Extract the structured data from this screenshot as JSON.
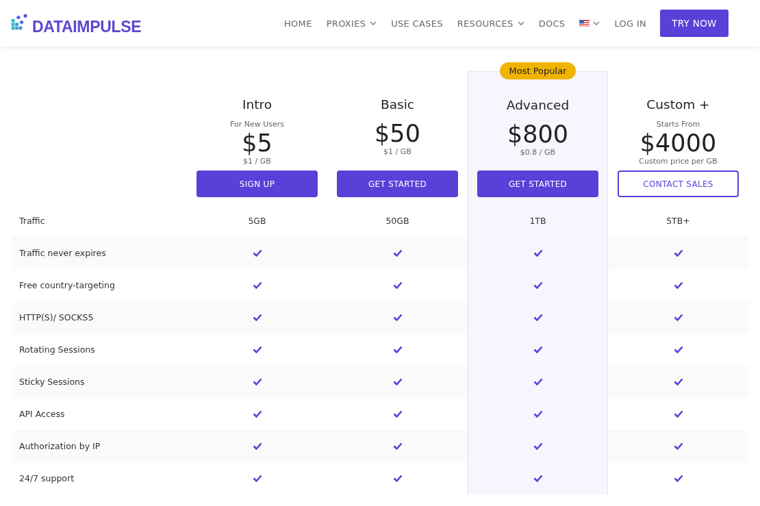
{
  "header": {
    "logo": "DATAIMPULSE",
    "nav": [
      {
        "kind": "link",
        "label": "HOME",
        "dropdown": false
      },
      {
        "kind": "link",
        "label": "PROXIES",
        "dropdown": true
      },
      {
        "kind": "link",
        "label": "USE CASES",
        "dropdown": false
      },
      {
        "kind": "link",
        "label": "RESOURCES",
        "dropdown": true
      },
      {
        "kind": "link",
        "label": "DOCS",
        "dropdown": false
      },
      {
        "kind": "flag",
        "dropdown": true
      },
      {
        "kind": "link",
        "label": "LOG IN",
        "dropdown": false
      },
      {
        "kind": "button",
        "label": "TRY NOW",
        "dropdown": false
      }
    ]
  },
  "plans": [
    {
      "name": "Intro",
      "subtitle": "For New Users",
      "price": "$5",
      "per_gb": "$1 / GB",
      "button": "SIGN UP",
      "kind": "filled",
      "popular": false
    },
    {
      "name": "Basic",
      "price": "$50",
      "per_gb": "$1 / GB",
      "button": "GET STARTED",
      "kind": "filled",
      "popular": false
    },
    {
      "name": "Advanced",
      "price": "$800",
      "per_gb": "$0.8 / GB",
      "button": "GET STARTED",
      "kind": "filled",
      "popular": true,
      "badge": "Most Popular"
    },
    {
      "name": "Custom +",
      "subtitle": "Starts From",
      "price": "$4000",
      "per_gb": "Custom price per GB",
      "button": "CONTACT SALES",
      "kind": "outline",
      "popular": false
    }
  ],
  "features": [
    {
      "label": "Traffic",
      "cells": [
        {
          "kind": "text",
          "text": "5GB"
        },
        {
          "kind": "text",
          "text": "50GB"
        },
        {
          "kind": "text",
          "text": "1TB"
        },
        {
          "kind": "text",
          "text": "5TB+"
        }
      ]
    },
    {
      "label": "Traffic never expires",
      "cells": [
        {
          "kind": "check",
          "included": true
        },
        {
          "kind": "check",
          "included": true
        },
        {
          "kind": "check",
          "included": true
        },
        {
          "kind": "check",
          "included": true
        }
      ]
    },
    {
      "label": "Free country-targeting",
      "cells": [
        {
          "kind": "check",
          "included": true
        },
        {
          "kind": "check",
          "included": true
        },
        {
          "kind": "check",
          "included": true
        },
        {
          "kind": "check",
          "included": true
        }
      ]
    },
    {
      "label": "HTTP(S)/ SOCKS5",
      "cells": [
        {
          "kind": "check",
          "included": true
        },
        {
          "kind": "check",
          "included": true
        },
        {
          "kind": "check",
          "included": true
        },
        {
          "kind": "check",
          "included": true
        }
      ]
    },
    {
      "label": "Rotating Sessions",
      "cells": [
        {
          "kind": "check",
          "included": true
        },
        {
          "kind": "check",
          "included": true
        },
        {
          "kind": "check",
          "included": true
        },
        {
          "kind": "check",
          "included": true
        }
      ]
    },
    {
      "label": "Sticky Sessions",
      "cells": [
        {
          "kind": "check",
          "included": true
        },
        {
          "kind": "check",
          "included": true
        },
        {
          "kind": "check",
          "included": true
        },
        {
          "kind": "check",
          "included": true
        }
      ]
    },
    {
      "label": "API Access",
      "cells": [
        {
          "kind": "check",
          "included": true
        },
        {
          "kind": "check",
          "included": true
        },
        {
          "kind": "check",
          "included": true
        },
        {
          "kind": "check",
          "included": true
        }
      ]
    },
    {
      "label": "Authorization by IP",
      "cells": [
        {
          "kind": "check",
          "included": true
        },
        {
          "kind": "check",
          "included": true
        },
        {
          "kind": "check",
          "included": true
        },
        {
          "kind": "check",
          "included": true
        }
      ]
    },
    {
      "label": "24/7 support",
      "cells": [
        {
          "kind": "check",
          "included": true
        },
        {
          "kind": "check",
          "included": true
        },
        {
          "kind": "check",
          "included": true
        },
        {
          "kind": "check",
          "included": true
        }
      ]
    }
  ]
}
